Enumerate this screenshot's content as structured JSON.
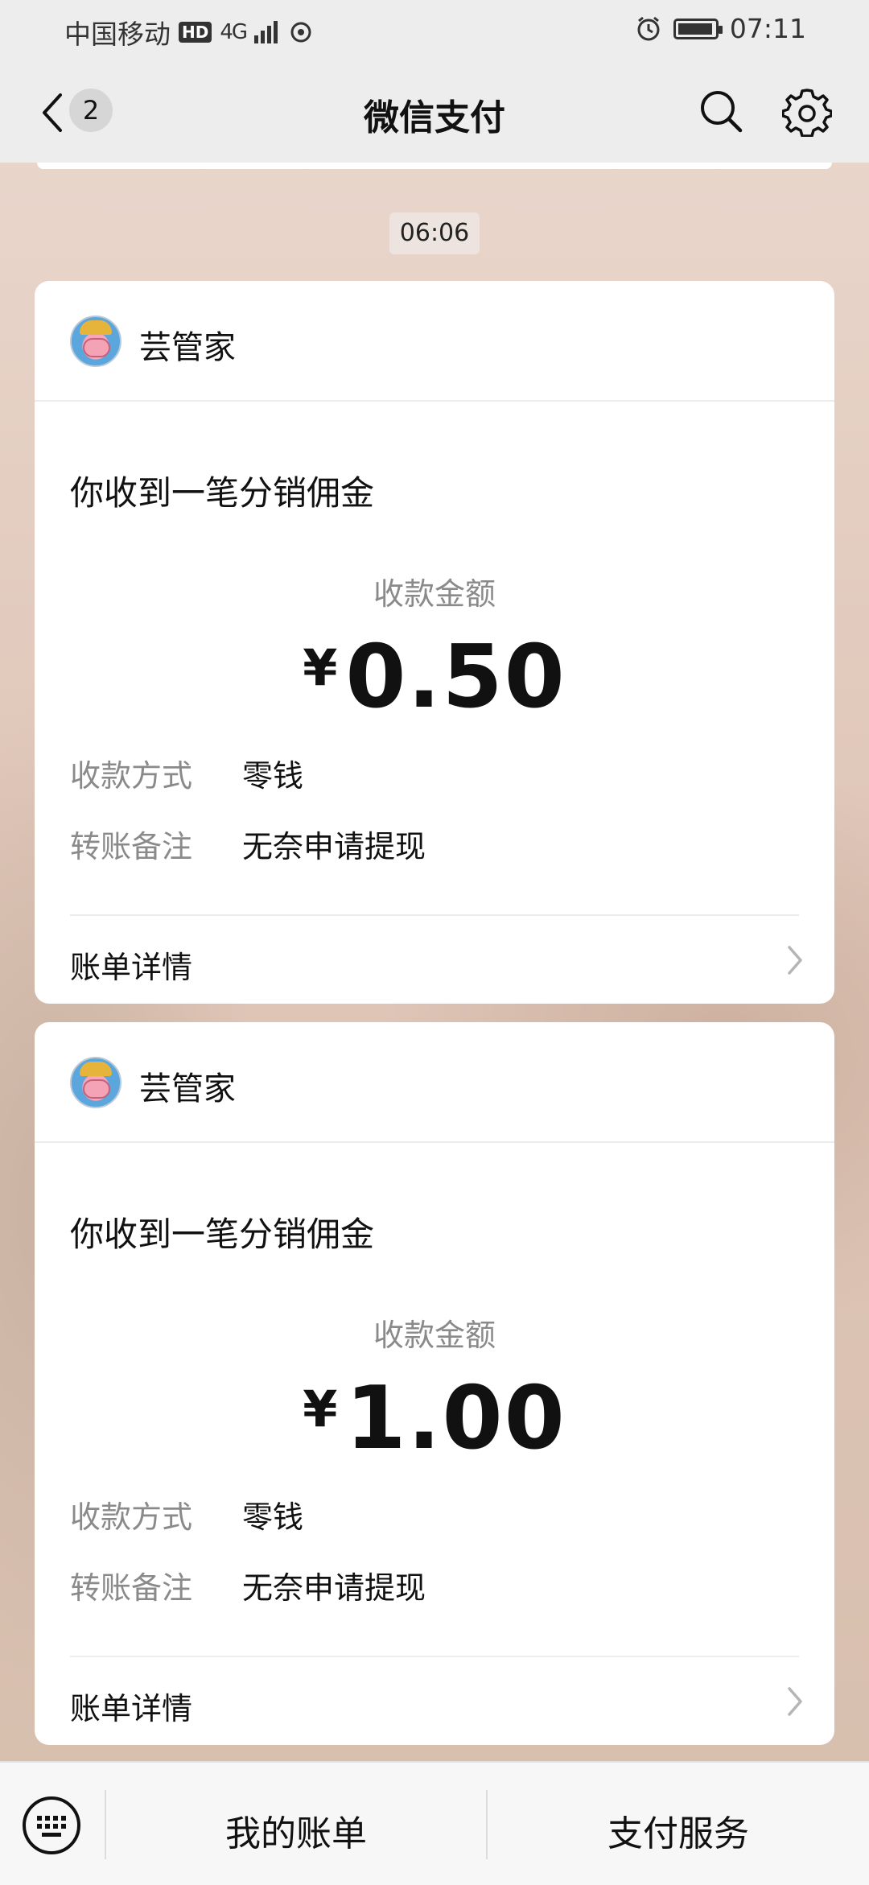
{
  "status_bar": {
    "carrier": "中国移动",
    "hd": "HD",
    "network": "4G",
    "time": "07:11",
    "battery_level": 0.85
  },
  "nav": {
    "back_badge": "2",
    "title": "微信支付"
  },
  "timestamp": "06:06",
  "messages": [
    {
      "sender": "芸管家",
      "headline": "你收到一笔分销佣金",
      "amount_label": "收款金额",
      "currency": "¥",
      "amount": "0.50",
      "method_label": "收款方式",
      "method_value": "零钱",
      "note_label": "转账备注",
      "note_value": "无奈申请提现",
      "details_label": "账单详情"
    },
    {
      "sender": "芸管家",
      "headline": "你收到一笔分销佣金",
      "amount_label": "收款金额",
      "currency": "¥",
      "amount": "1.00",
      "method_label": "收款方式",
      "method_value": "零钱",
      "note_label": "转账备注",
      "note_value": "无奈申请提现",
      "details_label": "账单详情"
    }
  ],
  "bottom_bar": {
    "keyboard_icon": "keyboard-icon",
    "tab1": "我的账单",
    "tab2": "支付服务"
  },
  "colors": {
    "nav_bg": "#ededed",
    "card_bg": "#ffffff",
    "muted_text": "#8a8a8a"
  }
}
